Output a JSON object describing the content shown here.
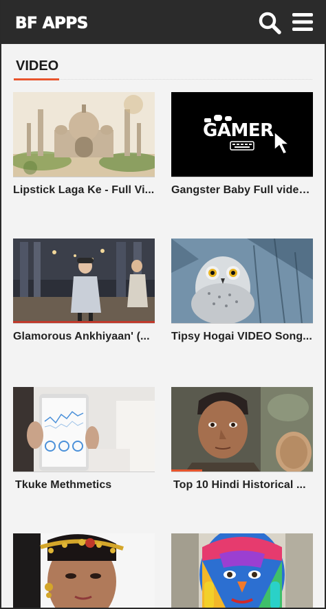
{
  "app": {
    "logo_text": "BF APPS"
  },
  "header": {
    "search_icon": "search-icon",
    "menu_icon": "menu-icon"
  },
  "section": {
    "title": "VIDEO",
    "accent_color": "#e8542c"
  },
  "videos": [
    {
      "title": "Lipstick Laga Ke - Full Vi...",
      "thumbnail": "taj-mahal-watercolor"
    },
    {
      "title": "Gangster Baby Full video...",
      "thumbnail": "gamer-logo"
    },
    {
      "title": "Glamorous Ankhiyaan' (...",
      "thumbnail": "women-walking-street"
    },
    {
      "title": "Tipsy Hogai VIDEO Song...",
      "thumbnail": "owl-in-snow"
    },
    {
      "title": "Tkuke Methmetics",
      "thumbnail": "tablet-chart"
    },
    {
      "title": "Top 10 Hindi Historical ...",
      "thumbnail": "boy-portrait",
      "progress": 0.22
    },
    {
      "title": "",
      "thumbnail": "bride-portrait"
    },
    {
      "title": "",
      "thumbnail": "painted-face"
    }
  ],
  "thumb_texts": {
    "gamer_logo": "GAMER"
  },
  "colors": {
    "topbar": "#2b2b2b",
    "background": "#f3f3f3"
  }
}
